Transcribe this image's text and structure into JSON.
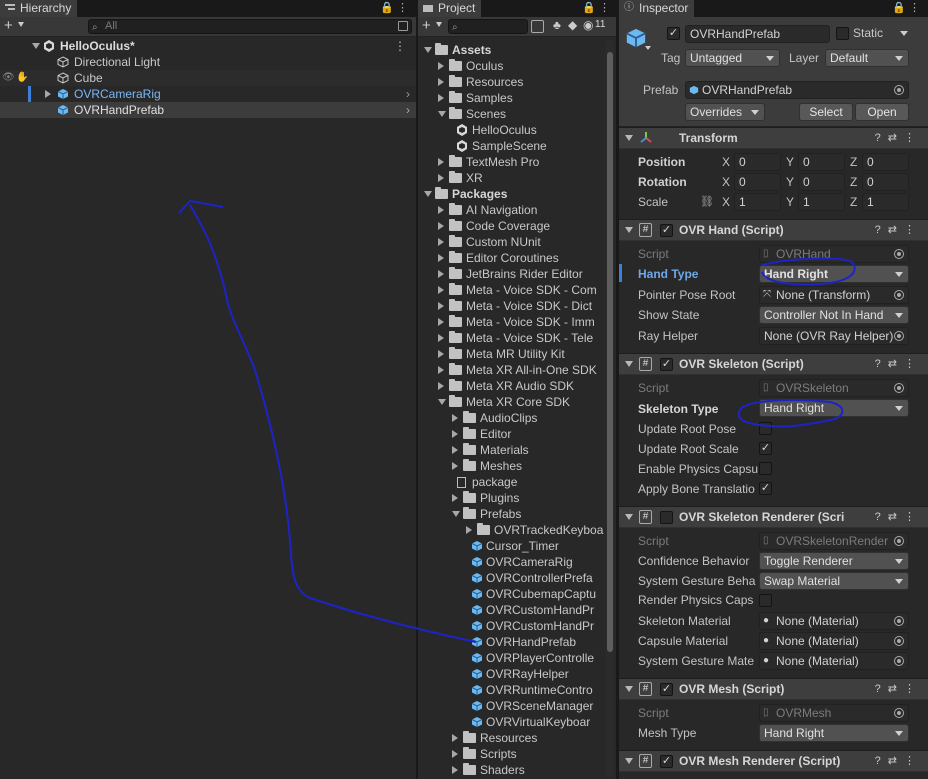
{
  "hierarchy": {
    "tab_label": "Hierarchy",
    "search_placeholder": "All",
    "scene_name": "HelloOculus*",
    "items": [
      "Directional Light",
      "Cube",
      "OVRCameraRig",
      "OVRHandPrefab"
    ]
  },
  "project": {
    "tab_label": "Project",
    "search_placeholder": "",
    "badge_count": "11",
    "assets_label": "Assets",
    "assets_items": [
      "Oculus",
      "Resources",
      "Samples",
      "Scenes",
      "HelloOculus",
      "SampleScene",
      "TextMesh Pro",
      "XR"
    ],
    "packages_label": "Packages",
    "packages_items": [
      "AI Navigation",
      "Code Coverage",
      "Custom NUnit",
      "Editor Coroutines",
      "JetBrains Rider Editor",
      "Meta - Voice SDK - Com",
      "Meta - Voice SDK - Dict",
      "Meta - Voice SDK - Imm",
      "Meta - Voice SDK - Tele",
      "Meta MR Utility Kit",
      "Meta XR All-in-One SDK",
      "Meta XR Audio SDK",
      "Meta XR Core SDK"
    ],
    "core_items": [
      "AudioClips",
      "Editor",
      "Materials",
      "Meshes",
      "package",
      "Plugins",
      "Prefabs"
    ],
    "prefab_items": [
      "OVRTrackedKeyboa",
      "Cursor_Timer",
      "OVRCameraRig",
      "OVRControllerPrefa",
      "OVRCubemapCaptu",
      "OVRCustomHandPr",
      "OVRCustomHandPr",
      "OVRHandPrefab",
      "OVRPlayerControlle",
      "OVRRayHelper",
      "OVRRuntimeContro",
      "OVRSceneManager",
      "OVRVirtualKeyboar"
    ],
    "tail_items": [
      "Resources",
      "Scripts",
      "Shaders"
    ]
  },
  "inspector": {
    "tab_label": "Inspector",
    "object_name": "OVRHandPrefab",
    "static_label": "Static",
    "tag_label": "Tag",
    "tag_value": "Untagged",
    "layer_label": "Layer",
    "layer_value": "Default",
    "prefab_label": "Prefab",
    "prefab_value": "OVRHandPrefab",
    "overrides_label": "Overrides",
    "select_label": "Select",
    "open_label": "Open",
    "transform": {
      "title": "Transform",
      "position_label": "Position",
      "position": [
        "0",
        "0",
        "0"
      ],
      "rotation_label": "Rotation",
      "rotation": [
        "0",
        "0",
        "0"
      ],
      "scale_label": "Scale",
      "scale": [
        "1",
        "1",
        "1"
      ],
      "axes": [
        "X",
        "Y",
        "Z"
      ]
    },
    "hand": {
      "title": "OVR Hand (Script)",
      "script_label": "Script",
      "script_value": "OVRHand",
      "hand_type_label": "Hand Type",
      "hand_type_value": "Hand Right",
      "pointer_label": "Pointer Pose Root",
      "pointer_value": "None (Transform)",
      "show_state_label": "Show State",
      "show_state_value": "Controller Not In Hand",
      "ray_label": "Ray Helper",
      "ray_value": "None (OVR Ray Helper)"
    },
    "skeleton": {
      "title": "OVR Skeleton (Script)",
      "script_label": "Script",
      "script_value": "OVRSkeleton",
      "type_label": "Skeleton Type",
      "type_value": "Hand Right",
      "update_root_pose": "Update Root Pose",
      "update_root_scale": "Update Root Scale",
      "enable_physics": "Enable Physics Capsu",
      "apply_bone": "Apply Bone Translatio"
    },
    "skel_renderer": {
      "title": "OVR Skeleton Renderer (Scri",
      "script_label": "Script",
      "script_value": "OVRSkeletonRender",
      "confidence_label": "Confidence Behavior",
      "confidence_value": "Toggle Renderer",
      "gesture_label": "System Gesture Beha",
      "gesture_value": "Swap Material",
      "render_caps_label": "Render Physics Caps",
      "skel_mat_label": "Skeleton Material",
      "skel_mat_value": "None (Material)",
      "caps_mat_label": "Capsule Material",
      "caps_mat_value": "None (Material)",
      "gesture_mat_label": "System Gesture Mate",
      "gesture_mat_value": "None (Material)"
    },
    "mesh": {
      "title": "OVR Mesh (Script)",
      "script_label": "Script",
      "script_value": "OVRMesh",
      "type_label": "Mesh Type",
      "type_value": "Hand Right"
    },
    "mesh_renderer": {
      "title": "OVR Mesh Renderer (Script)"
    }
  },
  "colors": {
    "accent": "#3d80d8",
    "annotation": "#1c24c8",
    "panel": "#282828"
  }
}
